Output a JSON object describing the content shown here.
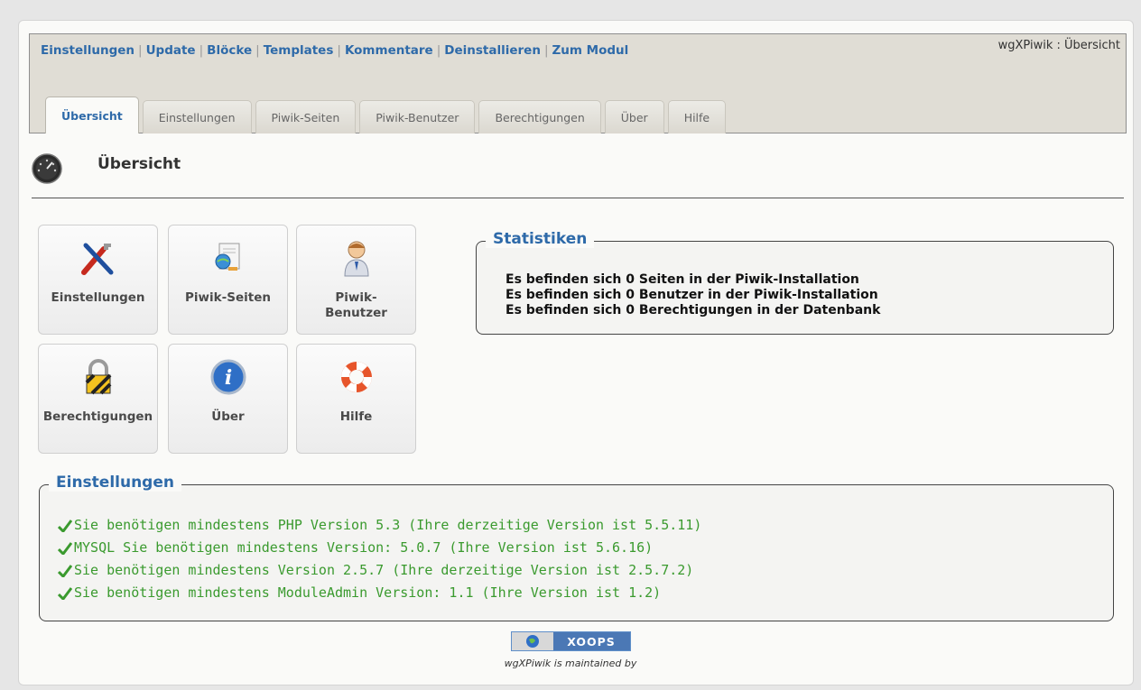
{
  "nav": {
    "links": [
      "Einstellungen",
      "Update",
      "Blöcke",
      "Templates",
      "Kommentare",
      "Deinstallieren",
      "Zum Modul"
    ],
    "module_title": "wgXPiwik : Übersicht"
  },
  "tabs": [
    "Übersicht",
    "Einstellungen",
    "Piwik-Seiten",
    "Piwik-Benutzer",
    "Berechtigungen",
    "Über",
    "Hilfe"
  ],
  "page": {
    "title": "Übersicht"
  },
  "icons": {
    "einstellungen": "Einstellungen",
    "piwik_seiten": "Piwik-Seiten",
    "piwik_benutzer_line1": "Piwik-",
    "piwik_benutzer_line2": "Benutzer",
    "berechtigungen": "Berechtigungen",
    "ueber": "Über",
    "hilfe": "Hilfe"
  },
  "stats": {
    "legend": "Statistiken",
    "lines": [
      "Es befinden sich 0 Seiten in der Piwik-Installation",
      "Es befinden sich 0 Benutzer in der Piwik-Installation",
      "Es befinden sich 0 Berechtigungen in der Datenbank"
    ]
  },
  "requirements": {
    "legend": "Einstellungen",
    "lines": [
      "Sie benötigen mindestens PHP Version 5.3 (Ihre derzeitige Version ist 5.5.11)",
      "MYSQL Sie benötigen mindestens Version: 5.0.7 (Ihre Version ist 5.6.16)",
      "Sie benötigen mindestens Version 2.5.7 (Ihre derzeitige Version ist 2.5.7.2)",
      "Sie benötigen mindestens ModuleAdmin Version: 1.1 (Ihre Version ist 1.2)"
    ]
  },
  "footer": {
    "badge": "XOOPS",
    "maintained": "wgXPiwik is maintained by"
  },
  "colors": {
    "link": "#2e6aa9",
    "ok_green": "#3a9a2e",
    "header_bg": "#e0ddd5"
  }
}
